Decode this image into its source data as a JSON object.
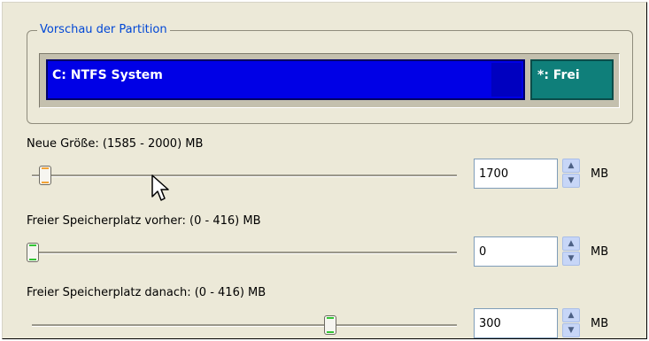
{
  "preview": {
    "legend": "Vorschau der Partition",
    "system_partition_label": "C: NTFS System",
    "free_partition_label": "*: Frei",
    "colors": {
      "system": "#0000e6",
      "free": "#0f7f7a",
      "legend": "#0047d6"
    }
  },
  "new_size": {
    "label": "Neue Größe: (1585 - 2000) MB",
    "value": "1700",
    "unit": "MB",
    "min": 1585,
    "max": 2000,
    "current": 1700,
    "thumb_color": "orange"
  },
  "free_before": {
    "label": "Freier Speicherplatz vorher: (0 - 416) MB",
    "value": "0",
    "unit": "MB",
    "min": 0,
    "max": 416,
    "current": 0,
    "thumb_color": "green"
  },
  "free_after": {
    "label": "Freier Speicherplatz danach: (0 - 416) MB",
    "value": "300",
    "unit": "MB",
    "min": 0,
    "max": 416,
    "current": 300,
    "thumb_color": "green"
  },
  "icons": {
    "spin_up": "chevron-up-icon",
    "spin_down": "chevron-down-icon",
    "cursor": "mouse-pointer-icon"
  }
}
